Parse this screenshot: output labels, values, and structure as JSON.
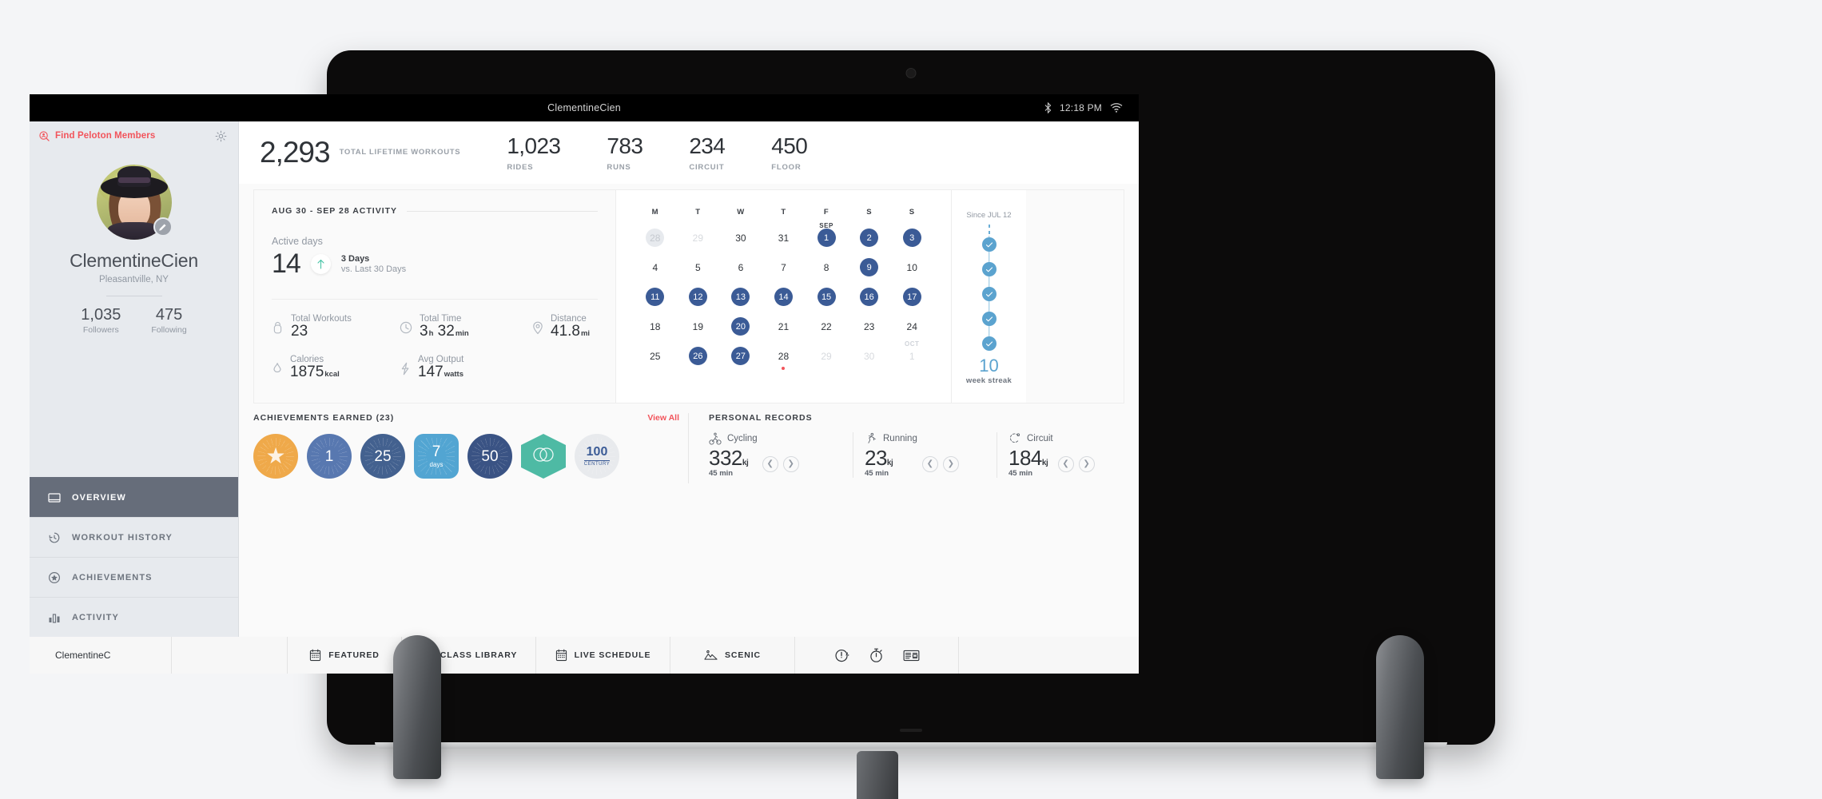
{
  "status_bar": {
    "title": "ClementineCien",
    "time": "12:18 PM",
    "bluetooth_icon": "bluetooth-icon",
    "wifi_icon": "wifi-icon"
  },
  "sidebar": {
    "find_members_label": "Find Peloton Members",
    "find_members_icon": "member-search-icon",
    "settings_icon": "gear-icon",
    "avatar_icon": "avatar",
    "edit_avatar_icon": "pencil-icon",
    "profile_name": "ClementineCien",
    "profile_location": "Pleasantville, NY",
    "followers_value": "1,035",
    "followers_label": "Followers",
    "following_value": "475",
    "following_label": "Following",
    "nav": [
      {
        "label": "OVERVIEW",
        "icon": "overview-icon",
        "active": true
      },
      {
        "label": "WORKOUT HISTORY",
        "icon": "history-clock-icon",
        "active": false
      },
      {
        "label": "ACHIEVEMENTS",
        "icon": "star-badge-icon",
        "active": false
      },
      {
        "label": "ACTIVITY",
        "icon": "bar-chart-icon",
        "active": false
      }
    ]
  },
  "lifetime": {
    "total_value": "2,293",
    "total_label": "TOTAL LIFETIME WORKOUTS",
    "stats": [
      {
        "value": "1,023",
        "label": "RIDES"
      },
      {
        "value": "783",
        "label": "RUNS"
      },
      {
        "value": "234",
        "label": "CIRCUIT"
      },
      {
        "value": "450",
        "label": "FLOOR"
      }
    ]
  },
  "activity": {
    "title": "AUG 30 - SEP 28 ACTIVITY",
    "active_days_label": "Active days",
    "active_days_value": "14",
    "trend_icon": "arrow-up-icon",
    "trend_value": "3 Days",
    "trend_compare": "vs. Last 30 Days",
    "metrics": [
      {
        "icon": "kettlebell-icon",
        "label": "Total Workouts",
        "value": "23",
        "unit": ""
      },
      {
        "icon": "clock-icon",
        "label": "Total Time",
        "value": "3",
        "unit": "h",
        "value2": "32",
        "unit2": "min"
      },
      {
        "icon": "map-pin-icon",
        "label": "Distance",
        "value": "41.8",
        "unit": "mi"
      },
      {
        "icon": "flame-icon",
        "label": "Calories",
        "value": "1875",
        "unit": "kcal"
      },
      {
        "icon": "bolt-icon",
        "label": "Avg Output",
        "value": "147",
        "unit": "watts"
      }
    ]
  },
  "calendar": {
    "weekdays": [
      "M",
      "T",
      "W",
      "T",
      "F",
      "S",
      "S"
    ],
    "filled_color": "#3b5b96",
    "today_dot_color": "#f2545b",
    "weeks": [
      [
        {
          "d": "28",
          "state": "today-ring"
        },
        {
          "d": "29",
          "state": "muted"
        },
        {
          "d": "30",
          "state": "plain"
        },
        {
          "d": "31",
          "state": "plain"
        },
        {
          "d": "1",
          "state": "filled",
          "month": "SEP"
        },
        {
          "d": "2",
          "state": "filled"
        },
        {
          "d": "3",
          "state": "filled"
        }
      ],
      [
        {
          "d": "4",
          "state": "plain"
        },
        {
          "d": "5",
          "state": "plain"
        },
        {
          "d": "6",
          "state": "plain"
        },
        {
          "d": "7",
          "state": "plain"
        },
        {
          "d": "8",
          "state": "plain"
        },
        {
          "d": "9",
          "state": "filled"
        },
        {
          "d": "10",
          "state": "plain"
        }
      ],
      [
        {
          "d": "11",
          "state": "filled"
        },
        {
          "d": "12",
          "state": "filled"
        },
        {
          "d": "13",
          "state": "filled"
        },
        {
          "d": "14",
          "state": "filled"
        },
        {
          "d": "15",
          "state": "filled"
        },
        {
          "d": "16",
          "state": "filled"
        },
        {
          "d": "17",
          "state": "filled"
        }
      ],
      [
        {
          "d": "18",
          "state": "plain"
        },
        {
          "d": "19",
          "state": "plain"
        },
        {
          "d": "20",
          "state": "filled"
        },
        {
          "d": "21",
          "state": "plain"
        },
        {
          "d": "22",
          "state": "plain"
        },
        {
          "d": "23",
          "state": "plain"
        },
        {
          "d": "24",
          "state": "plain"
        }
      ],
      [
        {
          "d": "25",
          "state": "plain"
        },
        {
          "d": "26",
          "state": "filled"
        },
        {
          "d": "27",
          "state": "filled"
        },
        {
          "d": "28",
          "state": "plain",
          "dot": true
        },
        {
          "d": "29",
          "state": "muted"
        },
        {
          "d": "30",
          "state": "muted"
        },
        {
          "d": "1",
          "state": "muted",
          "month": "OCT",
          "month_muted": true
        }
      ]
    ]
  },
  "streak": {
    "since_label": "Since JUL 12",
    "nodes": 5,
    "node_icon": "check-icon",
    "count": "10",
    "label": "week streak",
    "color": "#5ba3cf"
  },
  "achievements": {
    "title": "ACHIEVEMENTS EARNED (23)",
    "view_all_label": "View All",
    "badges": [
      {
        "name": "star-badge",
        "label": "",
        "shape": "circle",
        "color": "#efa94a",
        "icon": "star-icon"
      },
      {
        "name": "first-ride-badge",
        "label": "1",
        "shape": "circle",
        "color": "#5878b0"
      },
      {
        "name": "25-rides-badge",
        "label": "25",
        "shape": "circle",
        "color": "#43618f"
      },
      {
        "name": "7-day-streak-badge",
        "label": "7",
        "sub": "days",
        "shape": "rounded",
        "color": "#52a5d2"
      },
      {
        "name": "50-rides-badge",
        "label": "50",
        "shape": "circle",
        "color": "#3a5384"
      },
      {
        "name": "overlap-badge",
        "label": "",
        "shape": "hex",
        "color": "#4ebaa4",
        "icon": "rings-icon"
      },
      {
        "name": "century-badge",
        "label": "100",
        "sub": "CENTURY",
        "shape": "circle",
        "color": "#e8eaed"
      }
    ]
  },
  "records": {
    "title": "PERSONAL RECORDS",
    "prev_icon": "chevron-left-icon",
    "next_icon": "chevron-right-icon",
    "items": [
      {
        "icon": "cycling-icon",
        "name": "Cycling",
        "value": "332",
        "unit": "kj",
        "duration": "45 min"
      },
      {
        "icon": "running-icon",
        "name": "Running",
        "value": "23",
        "unit": "kj",
        "duration": "45 min"
      },
      {
        "icon": "circuit-icon",
        "name": "Circuit",
        "value": "184",
        "unit": "kj",
        "duration": "45 min"
      }
    ]
  },
  "bottom_nav": {
    "user_label": "ClementineC",
    "items": [
      {
        "label": "FEATURED",
        "icon": "calendar-icon"
      },
      {
        "label": "CLASS LIBRARY",
        "icon": "play-circle-icon"
      },
      {
        "label": "LIVE SCHEDULE",
        "icon": "calendar-icon"
      },
      {
        "label": "SCENIC",
        "icon": "mountain-icon"
      }
    ],
    "tools": [
      {
        "icon": "history-refresh-icon"
      },
      {
        "icon": "stopwatch-icon"
      },
      {
        "icon": "news-icon"
      }
    ]
  }
}
